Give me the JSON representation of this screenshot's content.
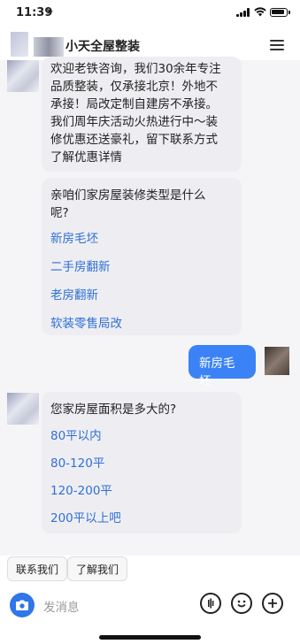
{
  "status": {
    "time": "11:39"
  },
  "header": {
    "title": "小天全屋整装"
  },
  "messages": {
    "welcome_lines": [
      "欢迎老铁咨询，我们30余年专注",
      "品质整装，仅承接北京！外地不",
      "承接！局改定制自建房不承接。",
      "我们周年庆活动火热进行中～装",
      "修优惠还送豪礼，留下联系方式",
      "了解优惠详情"
    ],
    "q1_lines": [
      "亲咱们家房屋装修类型是什么",
      "呢?"
    ],
    "q1_options": [
      "新房毛坯",
      "二手房翻新",
      "老房翻新",
      "软装零售局改"
    ],
    "my_reply": "新房毛坯",
    "q2_text": "您家房屋面积是多大的?",
    "q2_options": [
      "80平以内",
      "80-120平",
      "120-200平",
      "200平以上吧"
    ]
  },
  "quick_replies": [
    "联系我们",
    "了解我们"
  ],
  "input": {
    "placeholder": "发消息"
  },
  "icons": [
    "location-arrow-icon",
    "signal-icon",
    "wifi-icon",
    "battery-icon",
    "menu-icon",
    "camera-icon",
    "voice-icon",
    "emoji-icon",
    "plus-icon"
  ],
  "colors": {
    "accent": "#3b82f6",
    "option_link": "#2f6fd6",
    "bubble": "#eeeef2",
    "chat_bg": "#f5f5f7"
  }
}
